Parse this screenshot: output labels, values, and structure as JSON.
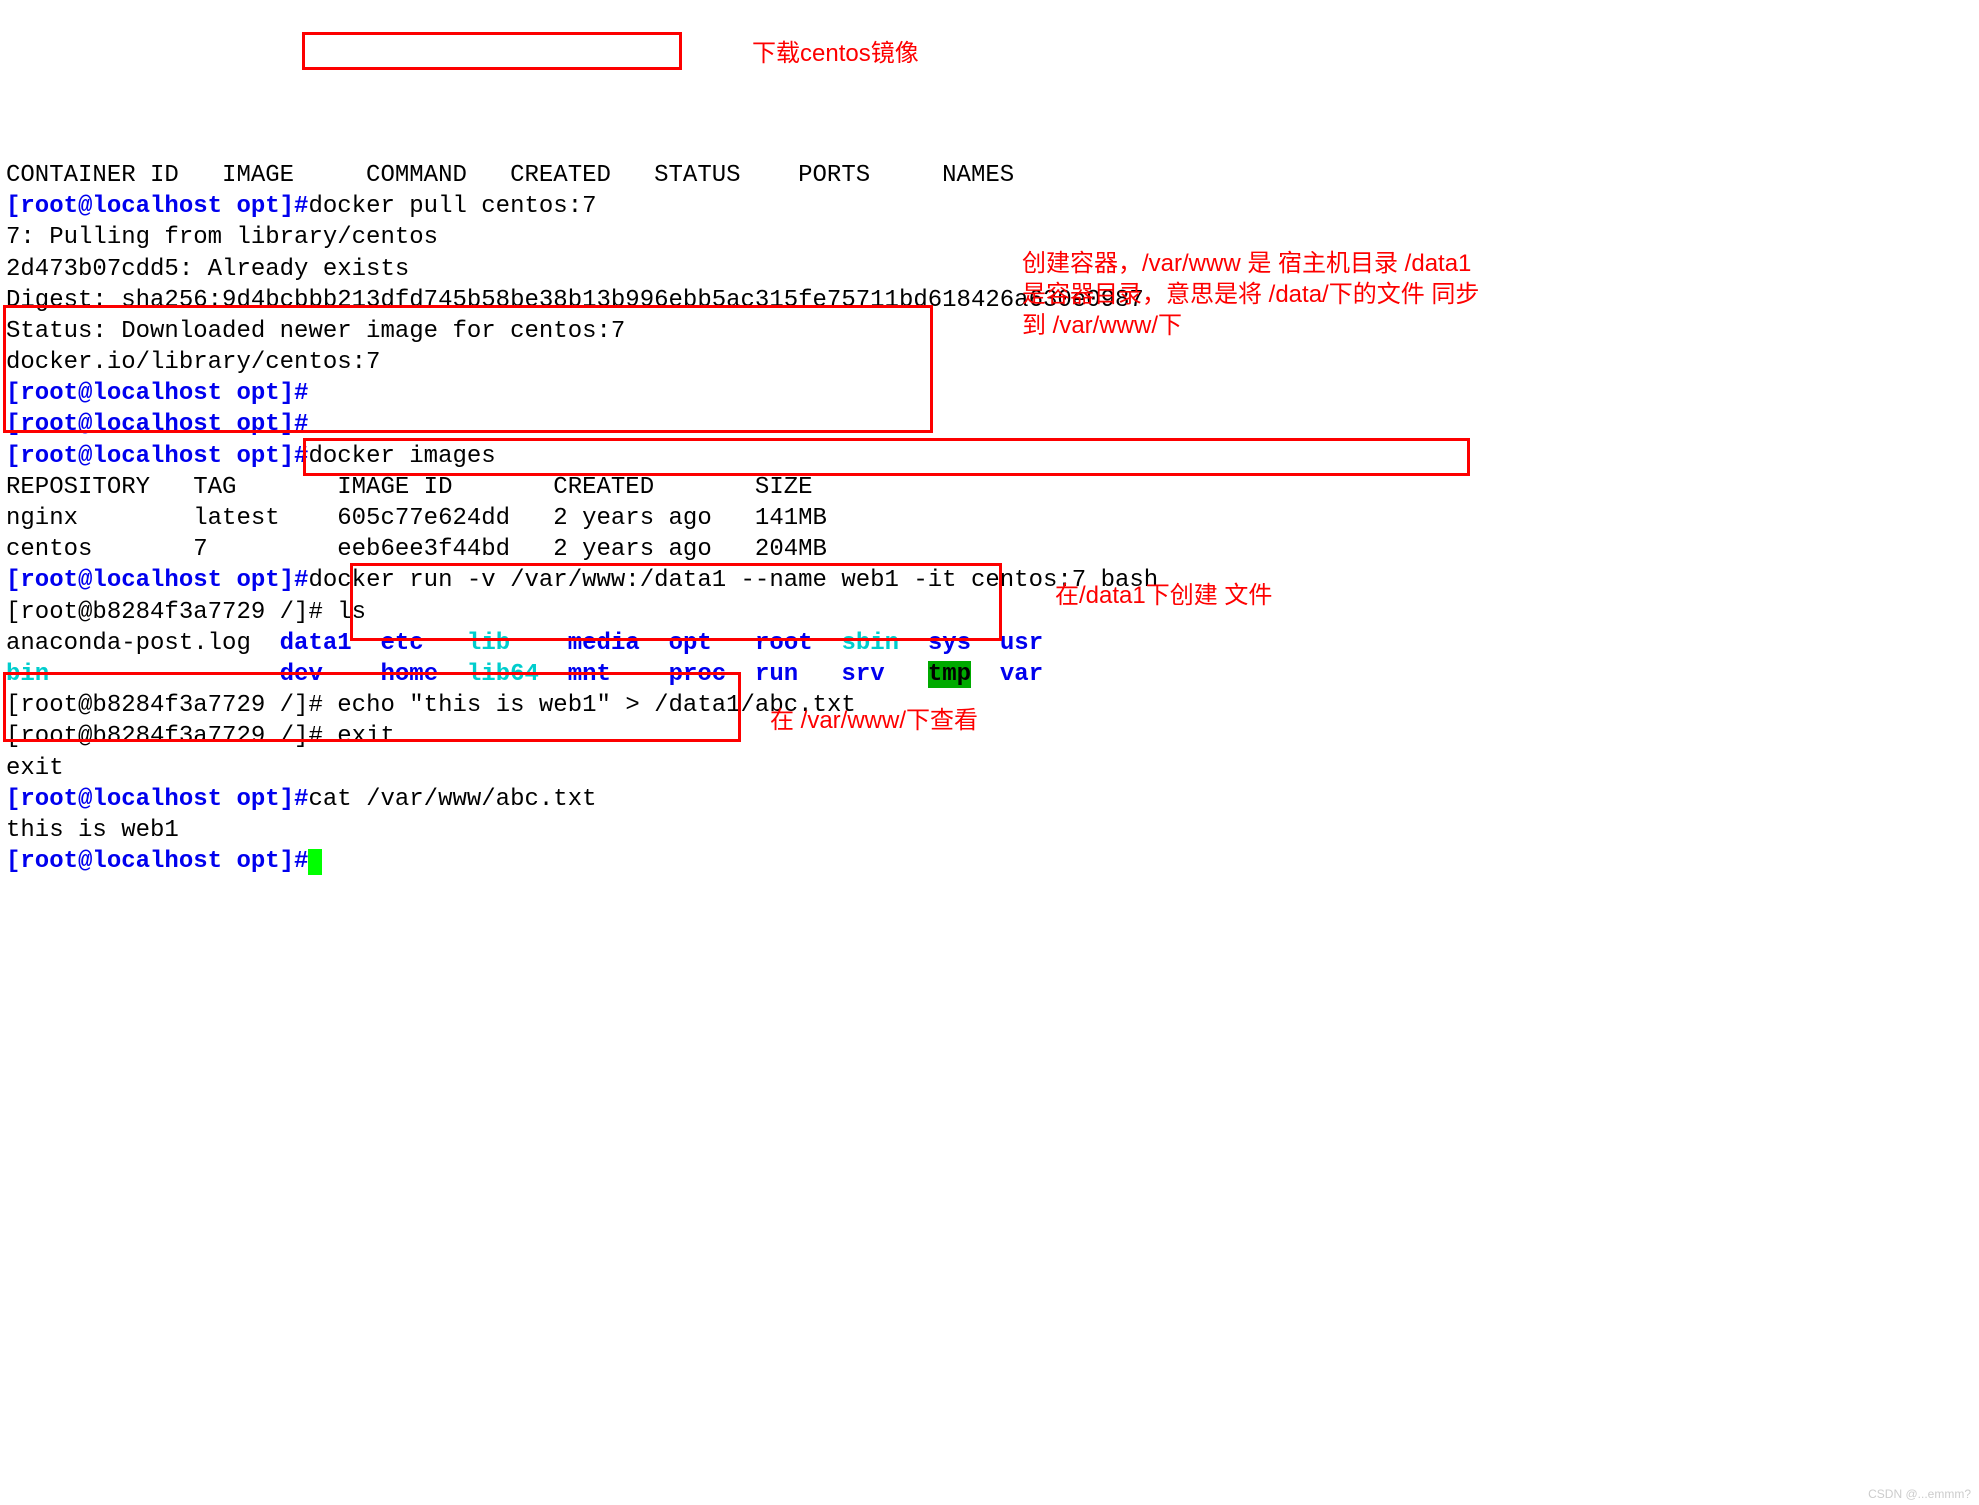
{
  "header": "CONTAINER ID   IMAGE     COMMAND   CREATED   STATUS    PORTS     NAMES",
  "prompt_host": "[root@localhost opt]#",
  "cmd1": "docker pull centos:7",
  "pull_out_1": "7: Pulling from library/centos",
  "pull_out_2": "2d473b07cdd5: Already exists",
  "pull_out_3": "Digest: sha256:9d4bcbbb213dfd745b58be38b13b996ebb5ac315fe75711bd618426a630e0987",
  "pull_out_4": "Status: Downloaded newer image for centos:7",
  "pull_out_5": "docker.io/library/centos:7",
  "cmd2": "docker images",
  "images_hdr": "REPOSITORY   TAG       IMAGE ID       CREATED       SIZE",
  "images_r1": "nginx        latest    605c77e624dd   2 years ago   141MB",
  "images_r2": "centos       7         eeb6ee3f44bd   2 years ago   204MB",
  "cmd3": "docker run -v /var/www:/data1 --name web1 -it centos:7 bash",
  "prompt_container": "[root@b8284f3a7729 /]# ",
  "ls_cmd": "ls",
  "ls_plain1": "anaconda-post.log  ",
  "ls_d1": "data1",
  "ls_d2": "etc",
  "ls_c1": "lib",
  "ls_d3": "media",
  "ls_d4": "opt",
  "ls_d5": "root",
  "ls_c2": "sbin",
  "ls_d6": "sys",
  "ls_d7": "usr",
  "ls_c3": "bin",
  "ls_d8": "dev",
  "ls_d9": "home",
  "ls_c4": "lib64",
  "ls_d10": "mnt",
  "ls_d11": "proc",
  "ls_d12": "run",
  "ls_d13": "srv",
  "ls_tmp": "tmp",
  "ls_d14": "var",
  "cmd4": "echo \"this is web1\" > /data1/abc.txt",
  "cmd5": "exit",
  "exit_echo": "exit",
  "cmd6": "cat /var/www/abc.txt",
  "cat_out": "this is web1",
  "anno1": "下载centos镜像",
  "anno2": "创建容器，/var/www 是 宿主机目录 /data1是容器目录，意思是将 /data/下的文件 同步到 /var/www/下",
  "anno3": "在/data1下创建 文件",
  "anno4": "在 /var/www/下查看",
  "watermark": "CSDN @...emmm?"
}
